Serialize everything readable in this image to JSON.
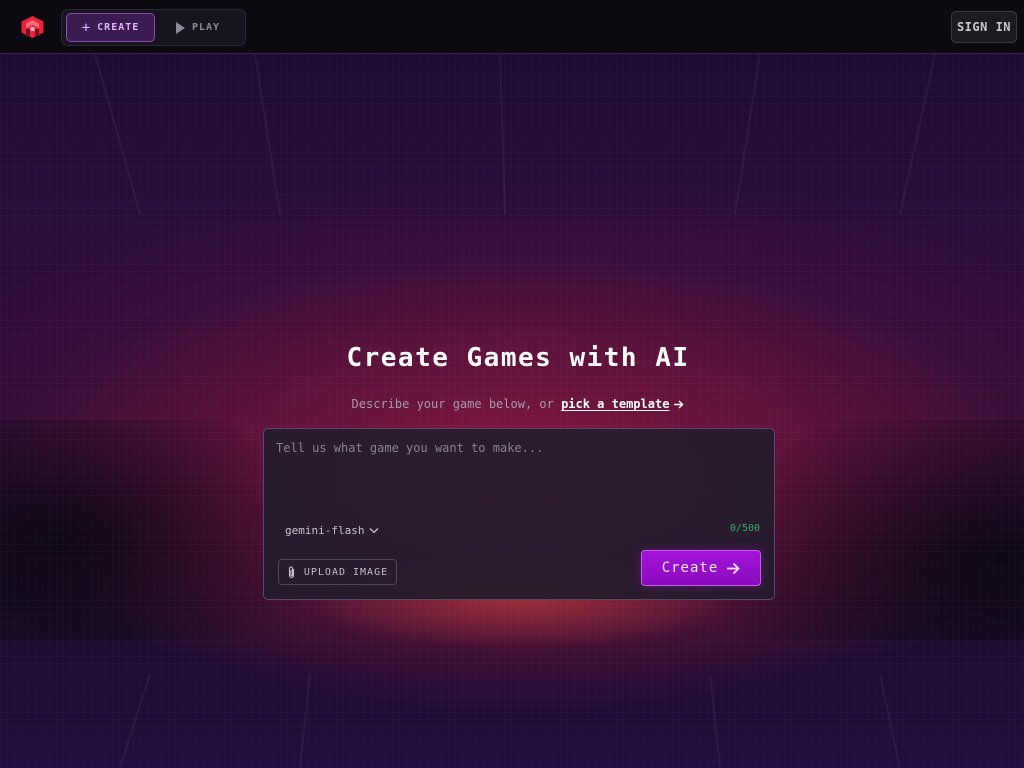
{
  "header": {
    "logo_icon": "red-hexagon-logo",
    "tabs": {
      "create_label": "CREATE",
      "play_label": "PLAY"
    },
    "signin_label": "SIGN IN"
  },
  "hero": {
    "title": "Create Games with AI",
    "subtitle_prefix": "Describe your game below, or ",
    "template_link": "pick a template"
  },
  "prompt": {
    "placeholder": "Tell us what game you want to make...",
    "value": "",
    "model": "gemini-flash",
    "counter": "0/500",
    "upload_label": "UPLOAD IMAGE",
    "create_label": "Create"
  },
  "colors": {
    "accent": "#a312d8",
    "active_tab": "#e2b2ff",
    "counter": "#3aa86a",
    "logo": "#e8243c"
  }
}
